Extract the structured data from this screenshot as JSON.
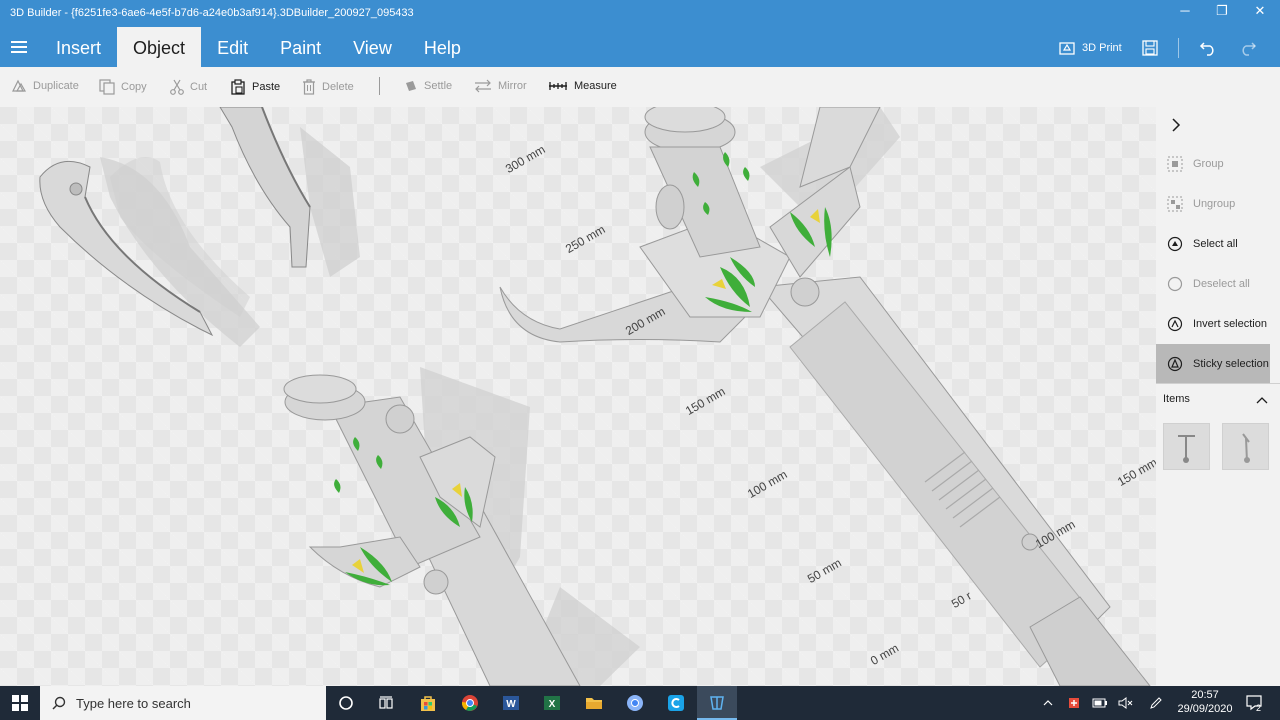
{
  "window": {
    "title": "3D Builder - {f6251fe3-6ae6-4e5f-b7d6-a24e0b3af914}.3DBuilder_200927_095433",
    "minimize": "─",
    "maximize": "❐",
    "close": "✕"
  },
  "menu": {
    "items": [
      {
        "label": "Insert"
      },
      {
        "label": "Object"
      },
      {
        "label": "Edit"
      },
      {
        "label": "Paint"
      },
      {
        "label": "View"
      },
      {
        "label": "Help"
      }
    ],
    "print_label": "3D Print"
  },
  "toolbar": {
    "duplicate": "Duplicate",
    "copy": "Copy",
    "cut": "Cut",
    "paste": "Paste",
    "delete": "Delete",
    "settle": "Settle",
    "mirror": "Mirror",
    "measure": "Measure"
  },
  "rulers": {
    "r300": "300 mm",
    "r250": "250 mm",
    "r200": "200 mm",
    "r150": "150 mm",
    "r100": "100 mm",
    "r50": "50 mm",
    "r0": "0 mm",
    "r150b": "150 mm",
    "r100b": "100 mm",
    "r50b": "50 r"
  },
  "side_panel": {
    "group": "Group",
    "ungroup": "Ungroup",
    "select_all": "Select all",
    "deselect_all": "Deselect all",
    "invert_selection": "Invert selection",
    "sticky_selection": "Sticky selection",
    "items_label": "Items"
  },
  "taskbar": {
    "search_placeholder": "Type here to search",
    "time": "20:57",
    "date": "29/09/2020",
    "notification_count": "2"
  },
  "colors": {
    "accent": "#3c8ed0",
    "model_green": "#3fae3a",
    "model_yellow": "#e8d23a"
  }
}
